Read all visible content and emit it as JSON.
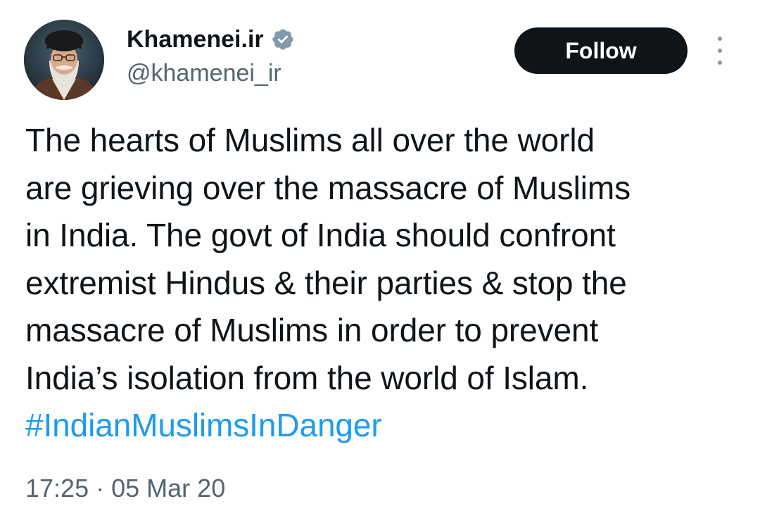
{
  "author": {
    "display_name": "Khamenei.ir",
    "handle": "@khamenei_ir",
    "verified": true,
    "verified_color": "#829aab"
  },
  "actions": {
    "follow_label": "Follow",
    "more_icon": "more-vertical-icon"
  },
  "tweet": {
    "text_lines": [
      "The hearts of Muslims all over the world",
      "are grieving over the massacre of Muslims",
      "in India. The govt of India should confront",
      "extremist Hindus & their parties & stop the",
      "massacre of Muslims in order to prevent",
      "India’s isolation from the world of Islam."
    ],
    "hashtag": "#IndianMuslimsInDanger",
    "hashtag_color": "#1d9bf0",
    "time": "17:25",
    "separator": "·",
    "date": "05 Mar 20"
  }
}
